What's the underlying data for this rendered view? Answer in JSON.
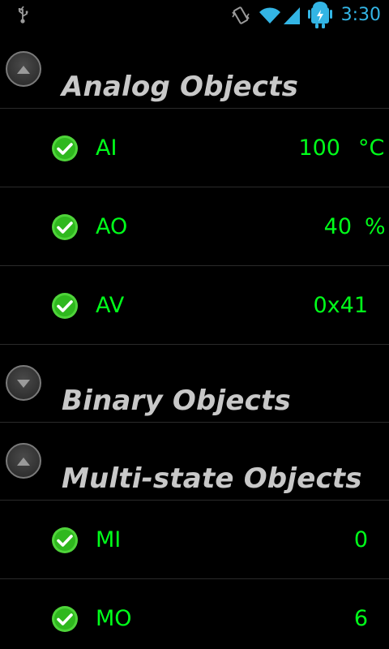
{
  "status_bar": {
    "time": "3:30",
    "icons": [
      "usb-icon",
      "vibrate-icon",
      "wifi-icon",
      "signal-icon",
      "battery-charging-icon"
    ],
    "clock_color": "#33b5e5"
  },
  "colors": {
    "value_green": "#00ff1a",
    "title_gray": "#c8c8c8"
  },
  "groups": [
    {
      "title": "Analog Objects",
      "expanded": true,
      "items": [
        {
          "name": "AI",
          "value": "100",
          "unit": "°C"
        },
        {
          "name": "AO",
          "value": "40",
          "unit": "%"
        },
        {
          "name": "AV",
          "value": "0x41",
          "unit": ""
        }
      ]
    },
    {
      "title": "Binary Objects",
      "expanded": false,
      "items": []
    },
    {
      "title": "Multi-state Objects",
      "expanded": true,
      "items": [
        {
          "name": "MI",
          "value": "0",
          "unit": ""
        },
        {
          "name": "MO",
          "value": "6",
          "unit": ""
        }
      ]
    }
  ]
}
